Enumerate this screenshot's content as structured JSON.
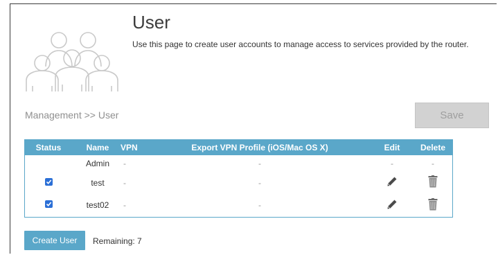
{
  "page": {
    "title": "User",
    "description": "Use this page to create user accounts to manage access to services provided by the router.",
    "breadcrumb": "Management >> User",
    "save_label": "Save"
  },
  "table": {
    "headers": {
      "status": "Status",
      "name": "Name",
      "vpn": "VPN",
      "export": "Export VPN Profile (iOS/Mac OS X)",
      "edit": "Edit",
      "delete": "Delete"
    },
    "rows": [
      {
        "status": "",
        "name": "Admin",
        "vpn": "-",
        "export": "-",
        "edit": "-",
        "delete": "-"
      },
      {
        "status": "checked",
        "name": "test",
        "vpn": "-",
        "export": "-",
        "edit": "pencil-icon",
        "delete": "trash-icon"
      },
      {
        "status": "checked",
        "name": "test02",
        "vpn": "-",
        "export": "-",
        "edit": "pencil-icon",
        "delete": "trash-icon"
      }
    ]
  },
  "footer": {
    "create_label": "Create User",
    "remaining": "Remaining: 7"
  },
  "colors": {
    "accent": "#5aa7c9",
    "checkbox": "#2b6fd6",
    "save_disabled": "#d2d2d2"
  }
}
